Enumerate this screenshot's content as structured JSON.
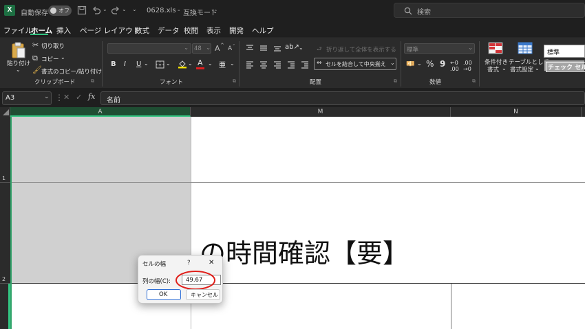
{
  "titlebar": {
    "app_icon_letter": "X",
    "autosave_label": "自動保存",
    "autosave_state": "オフ",
    "filename": "0628.xls",
    "mode": "互換モード",
    "search_placeholder": "検索"
  },
  "menu": [
    "ファイル",
    "ホーム",
    "挿入",
    "ページ レイアウト",
    "数式",
    "データ",
    "校閲",
    "表示",
    "開発",
    "ヘルプ"
  ],
  "active_menu": "ホーム",
  "ribbon": {
    "clipboard": {
      "paste": "貼り付け",
      "cut": "切り取り",
      "copy": "コピー",
      "format_painter": "書式のコピー/貼り付け",
      "label": "クリップボード"
    },
    "font": {
      "font_size": "48",
      "bold": "B",
      "italic": "I",
      "underline": "U",
      "grow": "A",
      "shrink": "A",
      "label": "フォント"
    },
    "alignment": {
      "wrap_text": "折り返して全体を表示する",
      "merge_center": "セルを結合して中央揃え",
      "label": "配置"
    },
    "number": {
      "format": "標準",
      "percent": "%",
      "comma": "9",
      "label": "数値"
    },
    "styles": {
      "conditional_line1": "条件付き",
      "conditional_line2": "書式",
      "table_line1": "テーブルとして",
      "table_line2": "書式設定",
      "style_normal": "標準",
      "style_check": "チェック セル"
    }
  },
  "formula_bar": {
    "name_box": "A3",
    "fx": "fx",
    "content": "名前"
  },
  "sheet": {
    "columns": [
      "A",
      "M",
      "N"
    ],
    "rows": [
      "1",
      "2"
    ],
    "cell_text": "の時間確認【要】"
  },
  "dialog": {
    "title": "セルの幅",
    "help": "?",
    "close": "✕",
    "field_label": "列の幅(C):",
    "field_value": "49.67",
    "ok": "OK",
    "cancel": "キャンセル",
    "annotation_color": "#e0201b"
  }
}
